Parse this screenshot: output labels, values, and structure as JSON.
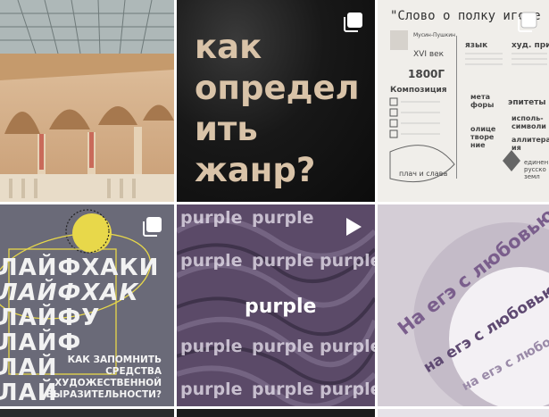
{
  "tiles": [
    {
      "type": "building-photo"
    },
    {
      "type": "text-post",
      "title": "как\nопредел\nить\nжанр?",
      "badge": "carousel-icon"
    },
    {
      "type": "text-post",
      "badge": "carousel-icon",
      "heading": "\"Слово о полку игоре",
      "lines": {
        "l1": "Мусин-Пушкин",
        "l2": "XVI век",
        "l3": "1800Г",
        "l4": "Композиция",
        "l5": "язык",
        "l6": "худ. прие",
        "l7": "эпитеты",
        "l8": "мета\nфоры",
        "l9": "исполь-\nсимволи",
        "l10": "олице\nтворе\nние",
        "l11": "аллитера\nия",
        "l12": "плач и слава",
        "l13": "единен\nрусско\nземл"
      }
    },
    {
      "type": "text-post",
      "badge": "carousel-icon",
      "lifehacks": [
        "ЛАЙФХАКИ",
        "ЛАЙФХАК",
        "ЛАЙФУ",
        "ЛАЙФ",
        "ЛАЙ",
        "ЛАЙ"
      ],
      "question": "КАК ЗАПОМНИТЬ\nСРЕДСТВА\nХУДОЖЕСТВЕННОЙ\nВЫРАЗИТЕЛЬНОСТИ?"
    },
    {
      "type": "video-post",
      "badge": "play-icon",
      "watermark": "purple",
      "logo": "purple"
    },
    {
      "type": "text-post",
      "curved": [
        "На егэ с любовью",
        "на егэ с любовью",
        "на егэ с любовью"
      ]
    }
  ],
  "colors": {
    "tile2_text": "#d9c3a8",
    "tile4_accent": "#e8d84a",
    "tile5_bg": "#5b4a68",
    "tile6_text": "#7a5e8c"
  }
}
